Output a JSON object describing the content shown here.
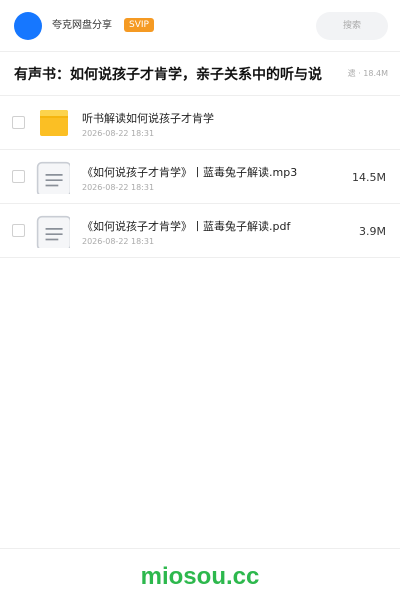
{
  "header": {
    "app_name": "夸克网盘分享",
    "badge": "SVIP",
    "search_placeholder": "搜索",
    "avatar_color": "#1677ff"
  },
  "share": {
    "title": "有声书：如何说孩子才肯学，亲子关系中的听与说",
    "meta": "遗 · 18.4M"
  },
  "files": [
    {
      "name": "听书解读如何说孩子才肯学",
      "date": "2026-08-22 18:31",
      "size": "",
      "icon": "folder-icon"
    },
    {
      "name": "《如何说孩子才肯学》丨蓝毒兔子解读.mp3",
      "date": "2026-08-22 18:31",
      "size": "14.5M",
      "icon": "document-icon"
    },
    {
      "name": "《如何说孩子才肯学》丨蓝毒兔子解读.pdf",
      "date": "2026-08-22 18:31",
      "size": "3.9M",
      "icon": "document-icon"
    }
  ],
  "footer": {
    "brand": "miosou.cc",
    "brand_color": "#2db84d"
  }
}
